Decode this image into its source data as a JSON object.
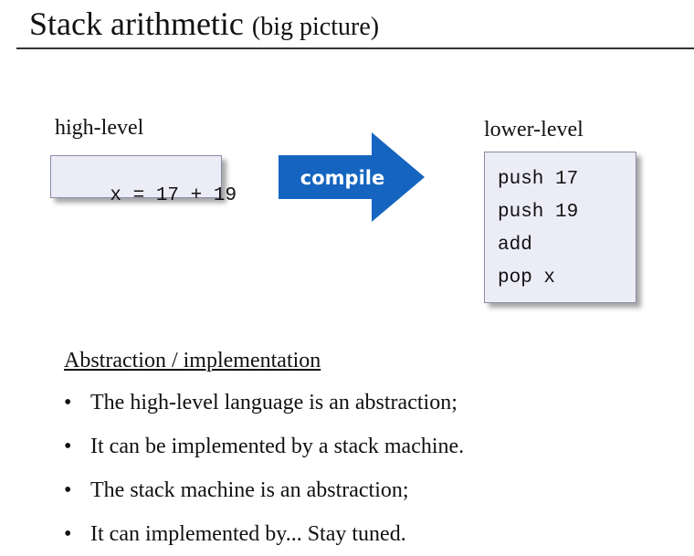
{
  "slide": {
    "title_main": "Stack arithmetic",
    "title_sub": "(big picture)"
  },
  "high_level": {
    "label": "high-level",
    "code": "x = 17 + 19"
  },
  "arrow": {
    "label": "compile",
    "color": "#1565c0"
  },
  "lower_level": {
    "label": "lower-level",
    "lines": [
      "push 17",
      "push 19",
      "add",
      "pop x"
    ]
  },
  "abstraction": {
    "heading": "Abstraction / implementation",
    "bullet_glyph": "•",
    "bullets": [
      "The high-level language is an abstraction;",
      "It can be implemented by a stack machine.",
      "The stack machine is an abstraction;",
      "It can implemented by... Stay tuned."
    ]
  }
}
